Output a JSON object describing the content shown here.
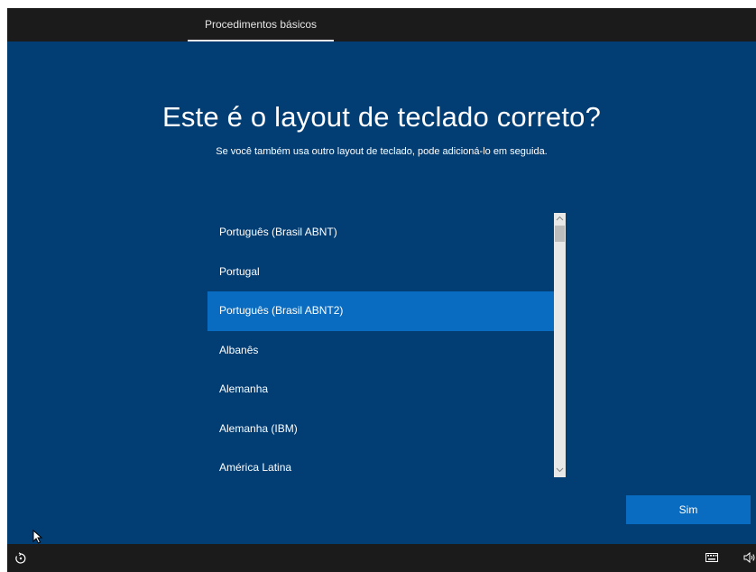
{
  "header": {
    "tab_label": "Procedimentos básicos"
  },
  "main": {
    "title": "Este é o layout de teclado correto?",
    "subtitle": "Se você também usa outro layout de teclado, pode adicioná-lo em seguida."
  },
  "keyboard_list": {
    "selected_index": 2,
    "items": [
      {
        "label": "Português (Brasil ABNT)"
      },
      {
        "label": "Portugal"
      },
      {
        "label": "Português (Brasil ABNT2)"
      },
      {
        "label": "Albanês"
      },
      {
        "label": "Alemanha"
      },
      {
        "label": "Alemanha (IBM)"
      },
      {
        "label": "América Latina"
      }
    ]
  },
  "actions": {
    "confirm_label": "Sim"
  },
  "icons": {
    "accessibility": "ease-of-access-icon",
    "keyboard": "keyboard-icon",
    "volume": "volume-icon",
    "scroll_up": "chevron-up-icon",
    "scroll_down": "chevron-down-icon"
  },
  "colors": {
    "background": "#023e74",
    "accent": "#0a6cc0",
    "bar": "#1b1b1b"
  }
}
